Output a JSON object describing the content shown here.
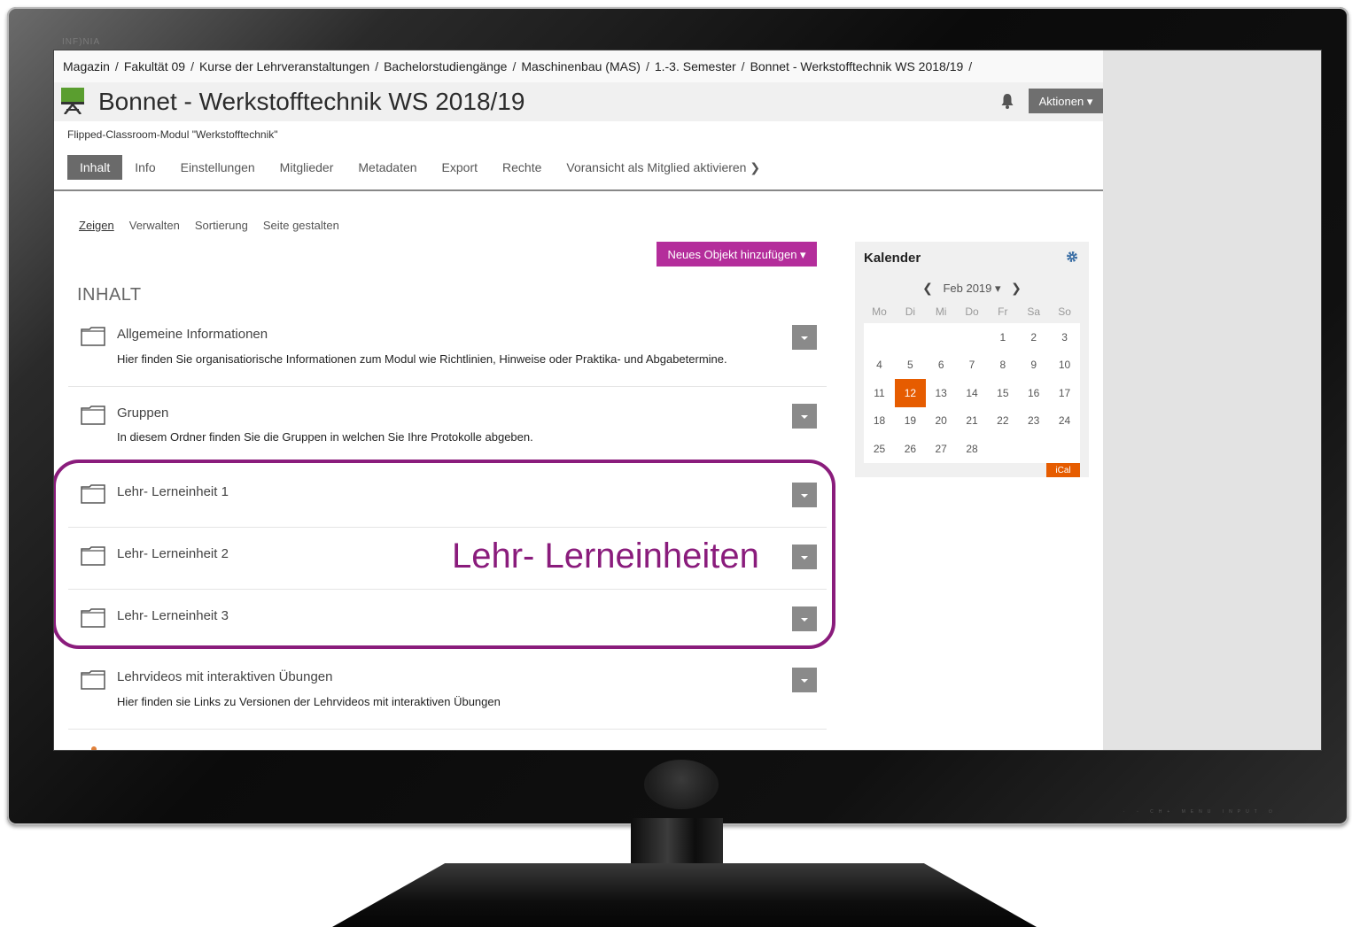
{
  "monitor": {
    "brand": "INF)NIA",
    "buttons": "· ◦ CH+ MENU INPUT ⏻"
  },
  "breadcrumb": [
    "Magazin",
    "Fakultät 09",
    "Kurse der Lehrveranstaltungen",
    "Bachelorstudiengänge",
    "Maschinenbau (MAS)",
    "1.-3. Semester",
    "Bonnet - Werkstofftechnik WS 2018/19"
  ],
  "breadcrumb_sep": "/",
  "header": {
    "title": "Bonnet - Werkstofftechnik WS 2018/19",
    "subtitle": "Flipped-Classroom-Modul \"Werkstofftechnik\"",
    "actions_label": "Aktionen ▾"
  },
  "tabs": [
    {
      "label": "Inhalt",
      "active": true
    },
    {
      "label": "Info"
    },
    {
      "label": "Einstellungen"
    },
    {
      "label": "Mitglieder"
    },
    {
      "label": "Metadaten"
    },
    {
      "label": "Export"
    },
    {
      "label": "Rechte"
    },
    {
      "label": "Voransicht als Mitglied aktivieren ❯"
    }
  ],
  "subtabs": [
    {
      "label": "Zeigen",
      "active": true
    },
    {
      "label": "Verwalten"
    },
    {
      "label": "Sortierung"
    },
    {
      "label": "Seite gestalten"
    }
  ],
  "add_button": "Neues Objekt hinzufügen ▾",
  "section_heading": "INHALT",
  "items": [
    {
      "name": "Allgemeine Informationen",
      "desc": "Hier finden Sie organisatiorische Informationen zum Modul wie Richtlinien, Hinweise oder Praktika- und Abgabetermine."
    },
    {
      "name": "Gruppen",
      "desc": "In diesem Ordner finden Sie die Gruppen in welchen Sie Ihre Protokolle abgeben."
    },
    {
      "name": "Lehr- Lerneinheit 1",
      "desc": ""
    },
    {
      "name": "Lehr- Lerneinheit 2",
      "desc": ""
    },
    {
      "name": "Lehr- Lerneinheit 3",
      "desc": ""
    },
    {
      "name": "Lehrvideos mit interaktiven Übungen",
      "desc": "Hier finden sie Links zu Versionen der Lehrvideos mit interaktiven Übungen"
    }
  ],
  "highlight_label": "Lehr- Lerneinheiten",
  "calendar": {
    "title": "Kalender",
    "month": "Feb 2019 ▾",
    "prev": "❮",
    "next": "❯",
    "weekdays": [
      "Mo",
      "Di",
      "Mi",
      "Do",
      "Fr",
      "Sa",
      "So"
    ],
    "weeks": [
      [
        "",
        "",
        "",
        "",
        "1",
        "2",
        "3"
      ],
      [
        "4",
        "5",
        "6",
        "7",
        "8",
        "9",
        "10"
      ],
      [
        "11",
        "12",
        "13",
        "14",
        "15",
        "16",
        "17"
      ],
      [
        "18",
        "19",
        "20",
        "21",
        "22",
        "23",
        "24"
      ],
      [
        "25",
        "26",
        "27",
        "28",
        "",
        "",
        ""
      ]
    ],
    "today": "12",
    "ical": "iCal"
  },
  "colors": {
    "accent": "#b42d9b",
    "highlight": "#8a1c7c",
    "today": "#e65c00",
    "tab_active": "#6a6a6a"
  }
}
